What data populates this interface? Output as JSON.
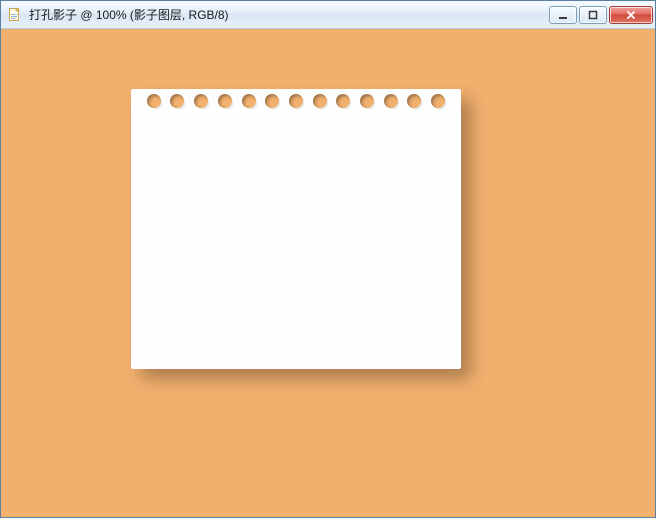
{
  "window": {
    "title": "打孔影子 @ 100% (影子图层, RGB/8)"
  },
  "controls": {
    "minimize_label": "Minimize",
    "maximize_label": "Maximize",
    "close_label": "Close"
  },
  "canvas": {
    "background_color": "#f2b06e",
    "paper_color": "#fefefe",
    "hole_count": 13
  },
  "icons": {
    "app": "document-icon"
  }
}
